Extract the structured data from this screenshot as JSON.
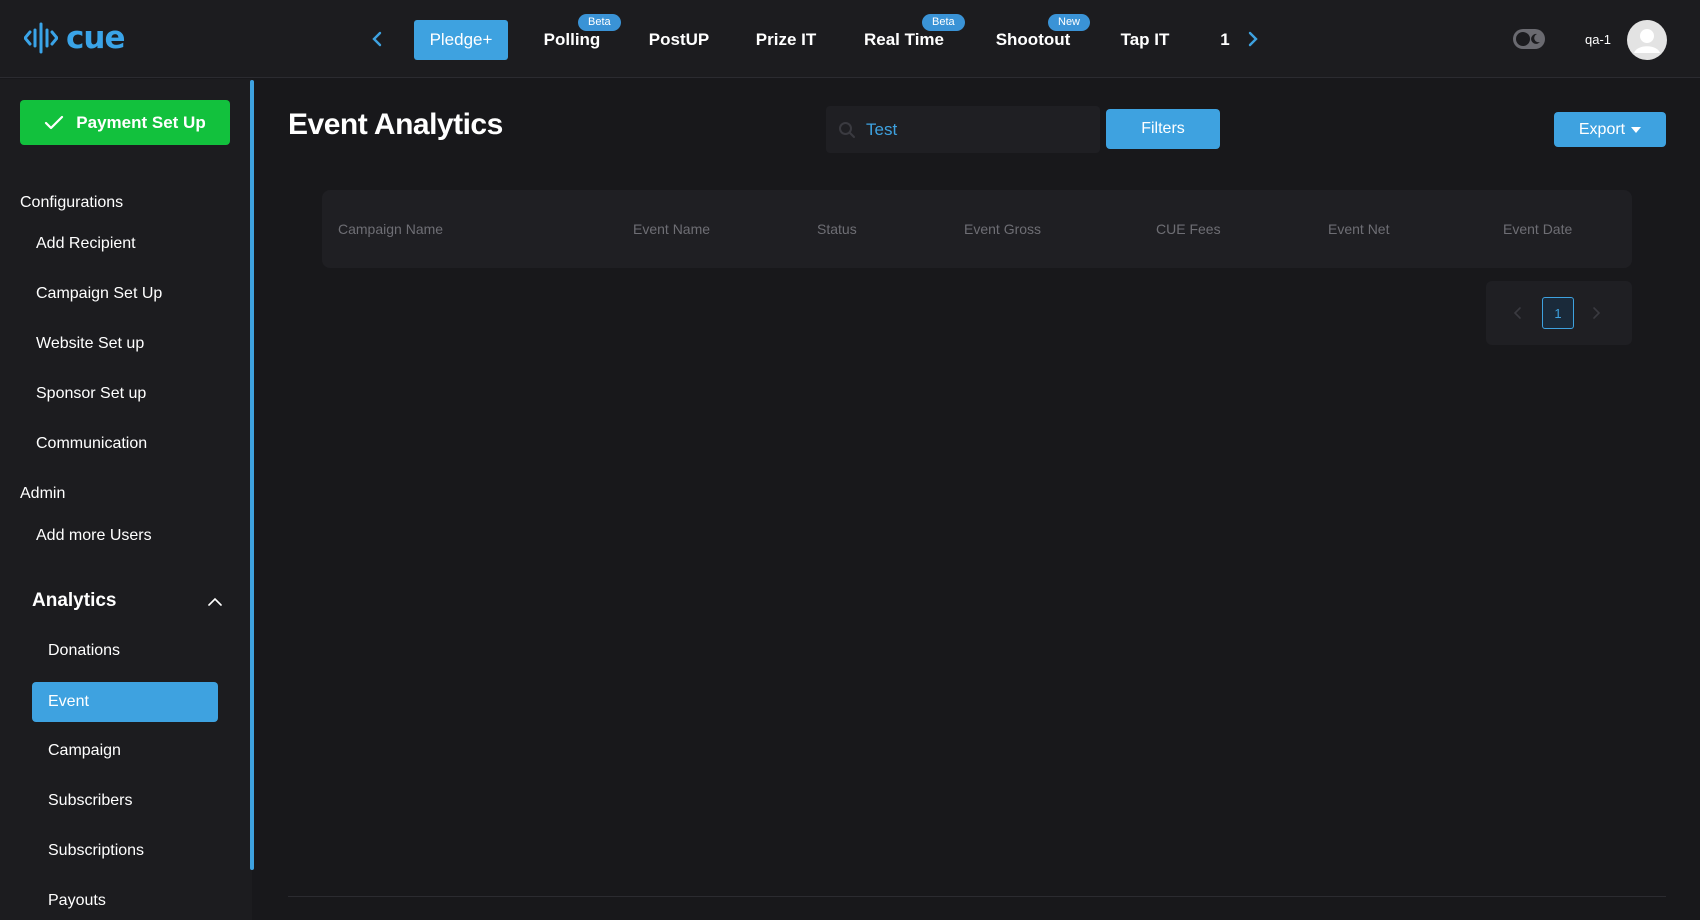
{
  "app": {
    "logo_text": "cue"
  },
  "topnav": {
    "tabs": [
      {
        "label": "Pledge+",
        "active": true,
        "badge": ""
      },
      {
        "label": "Polling",
        "active": false,
        "badge": "Beta"
      },
      {
        "label": "PostUP",
        "active": false,
        "badge": ""
      },
      {
        "label": "Prize IT",
        "active": false,
        "badge": ""
      },
      {
        "label": "Real Time",
        "active": false,
        "badge": "Beta"
      },
      {
        "label": "Shootout",
        "active": false,
        "badge": "New"
      },
      {
        "label": "Tap IT",
        "active": false,
        "badge": ""
      },
      {
        "label": "1",
        "active": false,
        "badge": ""
      }
    ],
    "username": "qa-1",
    "accent": "#3ea2e0"
  },
  "sidebar": {
    "payment_button": "Payment Set Up",
    "configurations_heading": "Configurations",
    "configurations_items": [
      "Add Recipient",
      "Campaign Set Up",
      "Website Set up",
      "Sponsor Set up",
      "Communication"
    ],
    "admin_heading": "Admin",
    "admin_items": [
      "Add more Users"
    ],
    "analytics_heading": "Analytics",
    "analytics_items": [
      "Donations",
      "Event",
      "Campaign",
      "Subscribers",
      "Subscriptions",
      "Payouts"
    ],
    "analytics_active": "Event"
  },
  "main": {
    "title": "Event Analytics",
    "search_value": "Test",
    "filters_label": "Filters",
    "export_label": "Export",
    "columns": [
      "Campaign Name",
      "Event Name",
      "Status",
      "Event Gross",
      "CUE Fees",
      "Event Net",
      "Event Date"
    ],
    "pagination": {
      "current_page": "1"
    }
  }
}
